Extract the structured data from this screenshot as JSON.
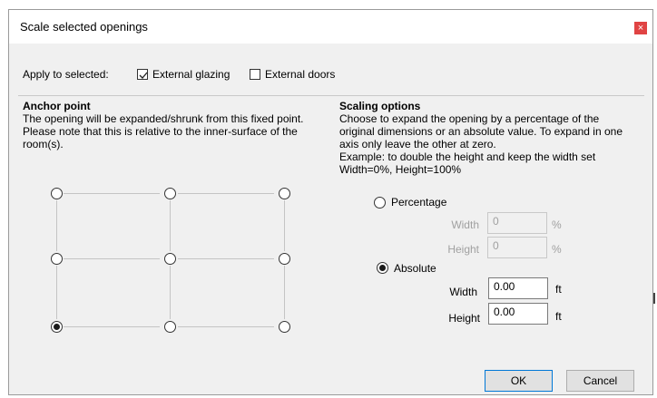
{
  "dialog": {
    "title": "Scale selected openings",
    "close_glyph": "×"
  },
  "apply": {
    "label": "Apply to selected:",
    "options": [
      {
        "label": "External glazing",
        "checked": true
      },
      {
        "label": "External doors",
        "checked": false
      }
    ]
  },
  "anchor": {
    "heading": "Anchor point",
    "description": "The opening will be expanded/shrunk from this fixed point. Please note that this is relative to the inner-surface of the room(s).",
    "selected": "bottom-left"
  },
  "scaling": {
    "heading": "Scaling options",
    "description_lines": [
      "Choose to expand the opening by a percentage of the",
      "original dimensions or an absolute value. To expand in one",
      "axis only leave the other at zero.",
      "Example: to double the height and keep the width set",
      "Width=0%, Height=100%"
    ],
    "percentage": {
      "label": "Percentage",
      "selected": false,
      "width_label": "Width",
      "width_value": "0",
      "height_label": "Height",
      "height_value": "0",
      "unit": "%"
    },
    "absolute": {
      "label": "Absolute",
      "selected": true,
      "width_label": "Width",
      "width_value": "0.00",
      "height_label": "Height",
      "height_value": "0.00",
      "unit": "ft"
    }
  },
  "buttons": {
    "ok": "OK",
    "cancel": "Cancel"
  },
  "colors": {
    "close_red": "#e04343",
    "default_button_border": "#0078d7"
  }
}
